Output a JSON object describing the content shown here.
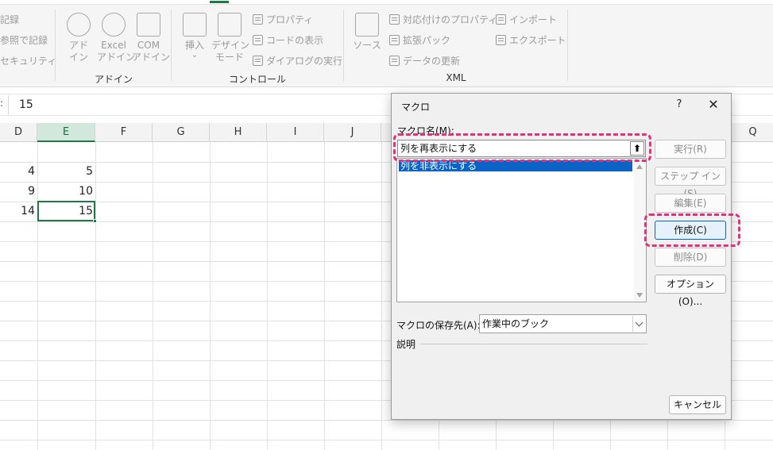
{
  "ribbon": {
    "left_items": [
      "記録",
      "参照で記録",
      "セキュリティ"
    ],
    "addins": {
      "addin": "アド\nイン",
      "excel_addin": "Excel\nアドイン",
      "com_addin": "COM\nアドイン",
      "group_label": "アドイン"
    },
    "controls": {
      "insert": "挿入",
      "design_mode": "デザイン\nモード",
      "properties": "プロパティ",
      "view_code": "コードの表示",
      "run_dialog": "ダイアログの実行",
      "group_label": "コントロール"
    },
    "xml": {
      "source": "ソース",
      "map_properties": "対応付けのプロパティ",
      "expansion_packs": "拡張パック",
      "refresh_data": "データの更新",
      "import": "インポート",
      "export": "エクスポート",
      "group_label": "XML"
    },
    "accent_color": "#1e7a45"
  },
  "formula_bar": {
    "value": "15"
  },
  "grid": {
    "columns": [
      "D",
      "E",
      "F",
      "G",
      "H",
      "I",
      "J",
      "Q"
    ],
    "selected_column": "E",
    "rows": [
      {
        "d": "4",
        "e": "5"
      },
      {
        "d": "9",
        "e": "10"
      },
      {
        "d": "14",
        "e": "15"
      }
    ]
  },
  "dialog": {
    "title": "マクロ",
    "help": "?",
    "close": "✕",
    "macro_name_label": "マクロ名(M):",
    "macro_name_value": "列を再表示にする",
    "list_items": [
      "列を非表示にする"
    ],
    "buttons": {
      "run": "実行(R)",
      "step_in": "ステップ イン(S)",
      "edit": "編集(E)",
      "create": "作成(C)",
      "delete": "削除(D)",
      "options": "オプション(O)..."
    },
    "store_label": "マクロの保存先(A):",
    "store_value": "作業中のブック",
    "description_label": "説明",
    "cancel": "キャンセル"
  },
  "highlight_color": "#e0337a"
}
